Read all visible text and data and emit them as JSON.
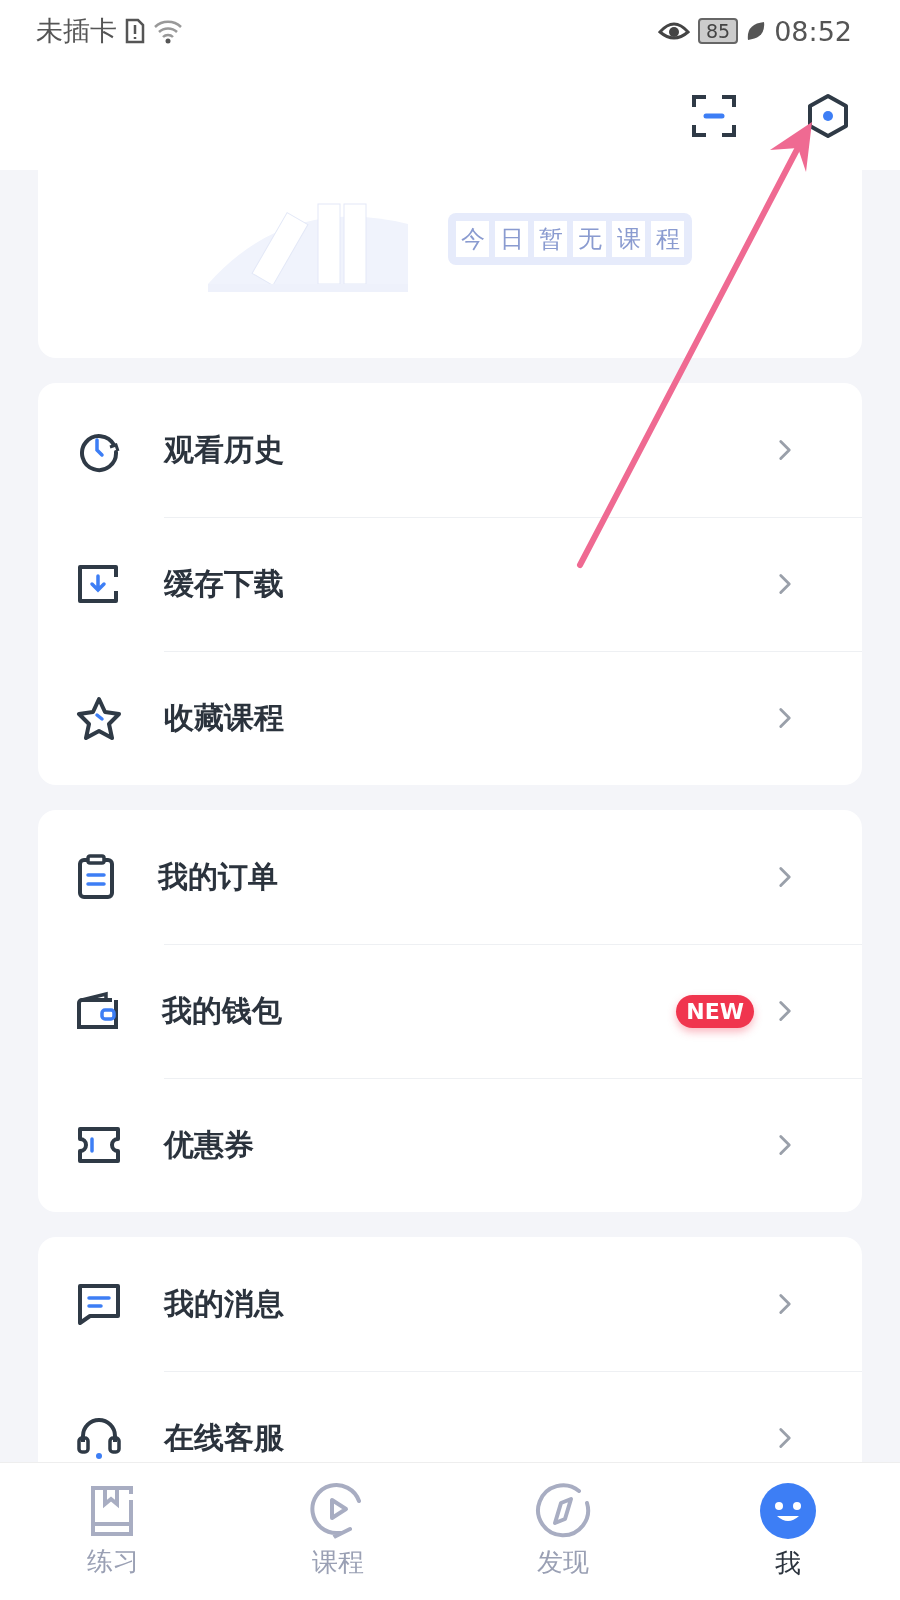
{
  "status_bar": {
    "carrier": "未插卡",
    "battery": "85",
    "time": "08:52"
  },
  "empty_state": {
    "text": "今日暂无课程"
  },
  "menu_groups": [
    {
      "items": [
        {
          "label": "观看历史"
        },
        {
          "label": "缓存下载"
        },
        {
          "label": "收藏课程"
        }
      ]
    },
    {
      "items": [
        {
          "label": "我的订单"
        },
        {
          "label": "我的钱包",
          "badge": "NEW"
        },
        {
          "label": "优惠券"
        }
      ]
    },
    {
      "items": [
        {
          "label": "我的消息"
        },
        {
          "label": "在线客服"
        }
      ]
    }
  ],
  "tab_bar": [
    {
      "label": "练习",
      "selected": false
    },
    {
      "label": "课程",
      "selected": false
    },
    {
      "label": "发现",
      "selected": false
    },
    {
      "label": "我",
      "selected": true
    }
  ]
}
